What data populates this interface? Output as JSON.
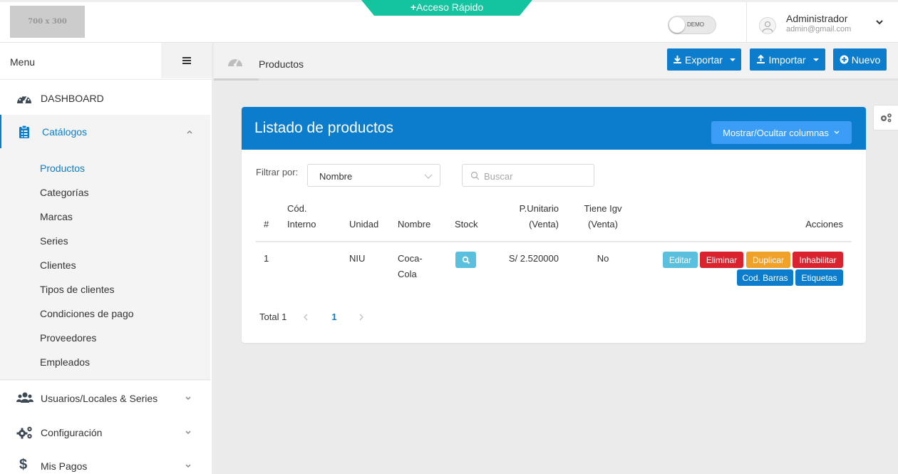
{
  "header": {
    "logo_text": "700 x 300",
    "quick_access": "Acceso Rápido",
    "demo_label": "DEMO",
    "user_name": "Administrador",
    "user_email": "admin@gmail.com"
  },
  "sidebar": {
    "menu_label": "Menu",
    "items": [
      {
        "label": "DASHBOARD",
        "icon": "dashboard-gauge-icon"
      },
      {
        "label": "Catálogos",
        "icon": "clipboard-icon",
        "expanded": true
      },
      {
        "label": "Usuarios/Locales & Series",
        "icon": "users-icon"
      },
      {
        "label": "Configuración",
        "icon": "gears-icon"
      },
      {
        "label": "Mis Pagos",
        "icon": "dollar-icon"
      }
    ],
    "subitems": [
      "Productos",
      "Categorías",
      "Marcas",
      "Series",
      "Clientes",
      "Tipos de clientes",
      "Condiciones de pago",
      "Proveedores",
      "Empleados"
    ],
    "active_subitem": "Productos"
  },
  "breadcrumb": {
    "current": "Productos"
  },
  "toolbar": {
    "export_label": "Exportar",
    "import_label": "Importar",
    "new_label": "Nuevo"
  },
  "card": {
    "title": "Listado de productos",
    "columns_button": "Mostrar/Ocultar columnas",
    "filter_label": "Filtrar por:",
    "filter_value": "Nombre",
    "search_placeholder": "Buscar"
  },
  "table": {
    "headers": {
      "num": "#",
      "cod_1": "Cód.",
      "cod_2": "Interno",
      "unidad": "Unidad",
      "nombre": "Nombre",
      "stock": "Stock",
      "pu_1": "P.Unitario",
      "pu_2": "(Venta)",
      "igv_1": "Tiene Igv",
      "igv_2": "(Venta)",
      "acciones": "Acciones"
    },
    "rows": [
      {
        "num": "1",
        "cod_interno": "",
        "unidad": "NIU",
        "nombre_1": "Coca-",
        "nombre_2": "Cola",
        "precio": "S/ 2.520000",
        "igv": "No"
      }
    ],
    "actions": {
      "edit": "Editar",
      "delete": "Eliminar",
      "duplicate": "Duplicar",
      "disable": "Inhabilitar",
      "barcode": "Cod. Barras",
      "labels": "Etiquetas"
    }
  },
  "pagination": {
    "total": "Total 1",
    "current_page": "1"
  },
  "colors": {
    "primary": "#0b7dcc",
    "quick_access": "#14c3a0",
    "info": "#5bc0de",
    "danger": "#d9232f",
    "warning": "#f0a12a",
    "columns_button": "#3b9df5"
  }
}
